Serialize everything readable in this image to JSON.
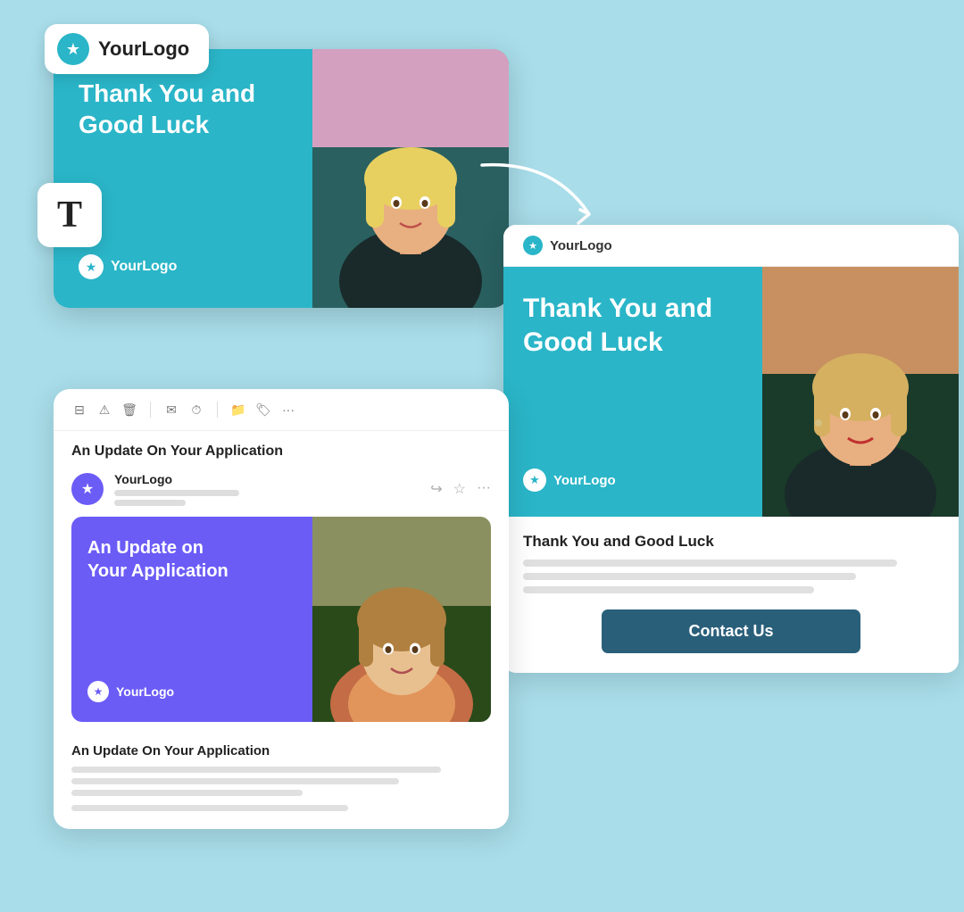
{
  "background_color": "#a8dde9",
  "logo": {
    "text": "YourLogo",
    "star_symbol": "★"
  },
  "top_card": {
    "title": "Thank You and\nGood Luck",
    "logo_text": "YourLogo"
  },
  "arrow": {
    "label": "curved-arrow"
  },
  "right_preview": {
    "header_logo": "YourLogo",
    "hero_title": "Thank You and\nGood Luck",
    "hero_logo": "YourLogo",
    "body_title": "Thank You and Good Luck",
    "contact_button_label": "Contact Us",
    "content_lines": [
      {
        "width": "90%"
      },
      {
        "width": "80%"
      },
      {
        "width": "70%"
      },
      {
        "width": "60%"
      }
    ]
  },
  "email_client": {
    "toolbar_icons": [
      "archive",
      "alert",
      "trash",
      "mail",
      "clock",
      "folder",
      "tag",
      "more"
    ],
    "subject": "An Update On Your Application",
    "sender_name": "YourLogo",
    "preview_card_title": "An Update on\nYour Application",
    "preview_card_logo": "YourLogo",
    "body_title": "An Update On Your Application",
    "body_lines": [
      {
        "width": "85%"
      },
      {
        "width": "75%"
      },
      {
        "width": "55%"
      },
      {
        "width": "65%"
      }
    ]
  },
  "text_tool_label": "T"
}
